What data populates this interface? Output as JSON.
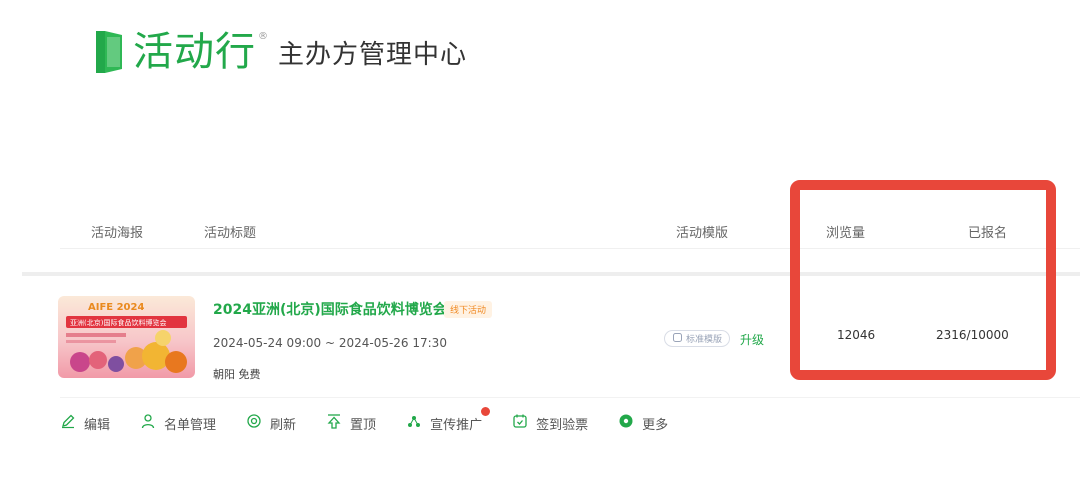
{
  "brand": {
    "name": "活动行",
    "reg_mark": "®",
    "subtitle": "主办方管理中心",
    "color": "#22a84a"
  },
  "table": {
    "headers": {
      "poster": "活动海报",
      "title": "活动标题",
      "template": "活动模版",
      "views": "浏览量",
      "registered": "已报名"
    },
    "row": {
      "poster": {
        "brand_text": "AIFE 2024",
        "name_text": "亚洲(北京)国际食品饮料博览会"
      },
      "title": "2024亚洲(北京)国际食品饮料博览会",
      "status_badge": "线下活动",
      "time_range": "2024-05-24 09:00 ~ 2024-05-26 17:30",
      "location_price": "朝阳 免费",
      "template_tag": "标准模版",
      "upgrade_label": "升级",
      "views": "12046",
      "registered": "2316/10000"
    }
  },
  "highlight": {
    "color": "#e8473a"
  },
  "actions": [
    {
      "label": "编辑",
      "icon": "pencil-icon"
    },
    {
      "label": "名单管理",
      "icon": "user-icon"
    },
    {
      "label": "刷新",
      "icon": "refresh-icon"
    },
    {
      "label": "置顶",
      "icon": "pin-top-icon"
    },
    {
      "label": "宣传推广",
      "icon": "share-icon"
    },
    {
      "label": "签到验票",
      "icon": "calendar-check-icon"
    },
    {
      "label": "更多",
      "icon": "more-icon"
    }
  ]
}
